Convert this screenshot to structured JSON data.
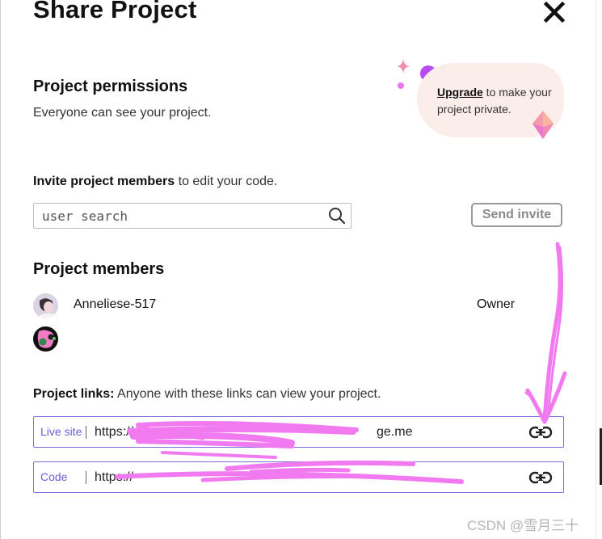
{
  "dialog": {
    "title": "Share Project",
    "close_icon": "close-icon"
  },
  "permissions": {
    "heading": "Project permissions",
    "description": "Everyone can see your project.",
    "upgrade_link": "Upgrade",
    "upgrade_rest": " to make your project private."
  },
  "invite": {
    "lead_bold": "Invite project members",
    "lead_rest": " to edit your code.",
    "search_placeholder": "user search",
    "search_icon": "search-icon",
    "send_button": "Send invite"
  },
  "members": {
    "heading": "Project members",
    "items": [
      {
        "name": "Anneliese-517",
        "role": "Owner"
      },
      {
        "name": "",
        "role": ""
      }
    ]
  },
  "links": {
    "lead_bold": "Project links:",
    "lead_rest": " Anyone with these links can view your project.",
    "items": [
      {
        "label": "Live site",
        "url": "https://",
        "url_tail": "ge.me",
        "icon": "link-icon"
      },
      {
        "label": "Code",
        "url": "https://",
        "icon": "link-icon"
      }
    ]
  },
  "colors": {
    "link_border": "#7b6ee0",
    "upgrade_bg": "#fbeeea",
    "annotation": "#f27af0"
  },
  "watermark": "CSDN @雪月三十"
}
